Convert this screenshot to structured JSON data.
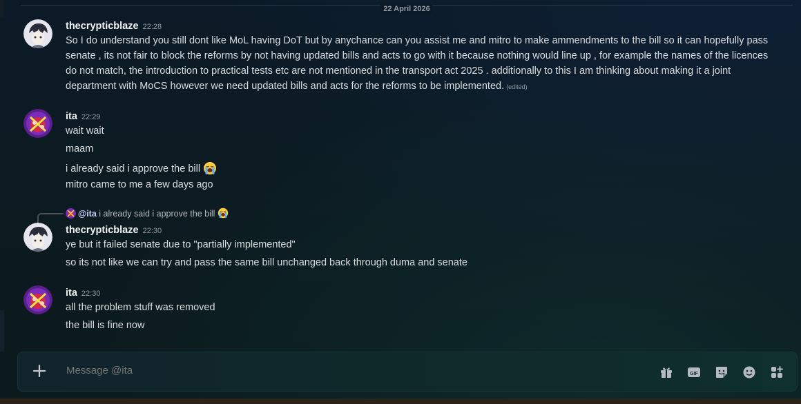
{
  "date_divider": "22 April 2026",
  "messages": [
    {
      "author": "thecrypticblaze",
      "time": "22:28",
      "text": "So I do understand you still dont like MoL having DoT but by anychance can you assist me and mitro to make ammendments to the bill so it can hopefully pass senate , its not fair to block the reforms by not having updated bills and acts to go with it because nothing would line up , for example the names of the licences do not match, the introduction to practical tests etc are not mentioned in the transport act 2025 . additionally to this I am thinking about making it a joint department with MoCS however we need updated bills and acts for the reforms to be implemented.",
      "edited": "(edited)"
    },
    {
      "author": "ita",
      "time": "22:29",
      "lines": [
        "wait wait",
        "maam",
        "i already said i approve the bill",
        "mitro came to me a few days ago"
      ]
    },
    {
      "reply": {
        "mention": "@ita",
        "text": "i already said i approve the bill"
      },
      "author": "thecrypticblaze",
      "time": "22:30",
      "lines": [
        "ye but it failed senate due to \"partially implemented\"",
        "so its not like we can try and pass the same bill unchanged back through duma and senate"
      ]
    },
    {
      "author": "ita",
      "time": "22:30",
      "lines": [
        "all the problem stuff was removed",
        "the bill is fine now"
      ]
    }
  ],
  "composer": {
    "placeholder": "Message @ita",
    "icons": [
      "plus-icon",
      "gift-icon",
      "gif-icon",
      "sticker-icon",
      "emoji-icon",
      "apps-icon"
    ]
  },
  "colors": {
    "accent": "#c9cdfb",
    "text": "#dbdee1",
    "muted": "#949ba4"
  }
}
